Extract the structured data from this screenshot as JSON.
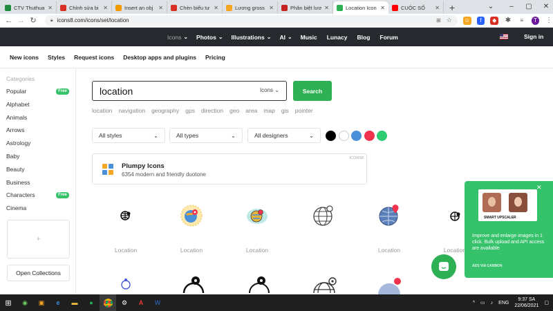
{
  "browser": {
    "tabs": [
      {
        "label": "CTV Thuthuat",
        "color": "#1e8e3e",
        "active": false
      },
      {
        "label": "Chỉnh sửa bi",
        "color": "#d93025",
        "active": false
      },
      {
        "label": "Insert an obj",
        "color": "#f29900",
        "active": false
      },
      {
        "label": "Chèn biểu tư",
        "color": "#d93025",
        "active": false
      },
      {
        "label": "Lương gross",
        "color": "#f5a623",
        "active": false
      },
      {
        "label": "Phân biệt lươ",
        "color": "#c5221f",
        "active": false
      },
      {
        "label": "Location Icon",
        "color": "#2db154",
        "active": true
      },
      {
        "label": "CUỘC SỐ",
        "color": "#ff0000",
        "active": false
      }
    ],
    "url": "icons8.com/icons/set/location",
    "profile_initial": "T"
  },
  "site_nav": {
    "items": [
      "Icons",
      "Photos",
      "Illustrations",
      "AI",
      "Music",
      "Lunacy",
      "Blog",
      "Forum"
    ],
    "signin": "Sign in"
  },
  "sub_nav": [
    "New icons",
    "Styles",
    "Request icons",
    "Desktop apps and plugins",
    "Pricing"
  ],
  "sidebar": {
    "heading": "Categories",
    "categories": [
      {
        "label": "Popular",
        "badge": "Free"
      },
      {
        "label": "Alphabet",
        "badge": ""
      },
      {
        "label": "Animals",
        "badge": ""
      },
      {
        "label": "Arrows",
        "badge": ""
      },
      {
        "label": "Astrology",
        "badge": ""
      },
      {
        "label": "Baby",
        "badge": ""
      },
      {
        "label": "Beauty",
        "badge": ""
      },
      {
        "label": "Business",
        "badge": ""
      },
      {
        "label": "Characters",
        "badge": "Free"
      },
      {
        "label": "Cinema",
        "badge": ""
      }
    ],
    "add_symbol": "+",
    "open_collections": "Open Collections"
  },
  "search": {
    "query": "location",
    "type": "Icons",
    "button": "Search",
    "related": [
      "location",
      "navigation",
      "geography",
      "gps",
      "direction",
      "geo",
      "area",
      "map",
      "gis",
      "pointer"
    ]
  },
  "filters": [
    "All styles",
    "All types",
    "All designers"
  ],
  "colors": [
    "#000000",
    "#ffffff",
    "#4a90d9",
    "#f0334d",
    "#2ecc71"
  ],
  "plumpy": {
    "title": "Plumpy Icons",
    "subtitle": "6354 modern and friendly duotone",
    "tag": "ICONS8"
  },
  "icon_label": "Location",
  "icon_labels": [
    "Location",
    "Location",
    "Location",
    "Location",
    "Location",
    "Location"
  ],
  "ad": {
    "badge": "SMART UPSCALER",
    "text": "Improve and enlarge images in 1 click. Bulk upload and API access are available",
    "via": "ADS VIA CARBON"
  },
  "taskbar": {
    "lang": "ENG",
    "time": "9:37 SA",
    "date": "22/06/2021"
  }
}
